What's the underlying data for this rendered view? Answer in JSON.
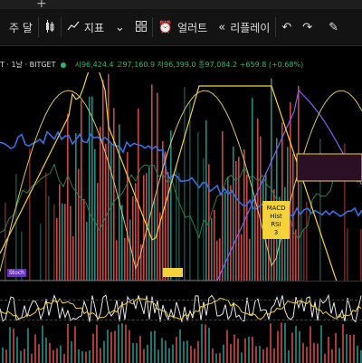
{
  "toolbar": {
    "interval": "주 달",
    "indicators": "지표",
    "alert": "얼러트",
    "replay": "리플레이"
  },
  "legend": {
    "symbol": "T · 1날 · BITGET",
    "ohlc": "시96,424.4 고97,160.9 저96,399.0 종97,084.2 +659.8 (+0.68%)"
  },
  "badges": {
    "macd": "MACD",
    "hist": "Hist",
    "rsi": "RSI",
    "count": "3",
    "stoch": "Stoch"
  },
  "colors": {
    "background": "#000000",
    "up": "#26a69a",
    "down": "#ef5350",
    "accent": "#f3d23a",
    "price_line": "#3b6fe0",
    "purple": "#8a5cf5"
  }
}
